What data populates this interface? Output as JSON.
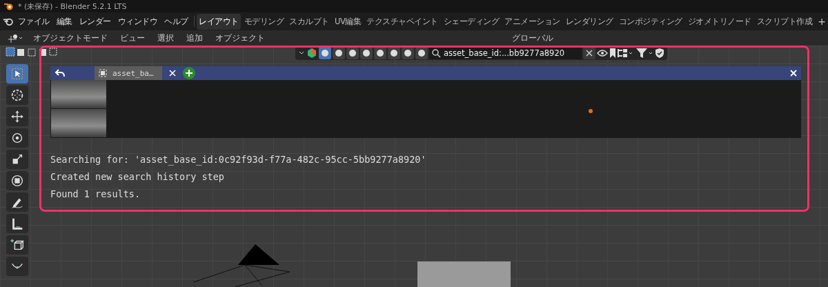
{
  "window": {
    "title": "* (未保存) - Blender 5.2.1 LTS"
  },
  "menu_bar": {
    "menus": [
      "ファイル",
      "編集",
      "レンダー",
      "ウィンドウ",
      "ヘルプ"
    ],
    "workspaces": [
      {
        "label": "レイアウト",
        "selected": true
      },
      {
        "label": "モデリング",
        "selected": false
      },
      {
        "label": "スカルプト",
        "selected": false
      },
      {
        "label": "UV編集",
        "selected": false
      },
      {
        "label": "テクスチャペイント",
        "selected": false
      },
      {
        "label": "シェーディング",
        "selected": false
      },
      {
        "label": "アニメーション",
        "selected": false
      },
      {
        "label": "レンダリング",
        "selected": false
      },
      {
        "label": "コンポジティング",
        "selected": false
      },
      {
        "label": "ジオメトリノード",
        "selected": false
      },
      {
        "label": "スクリプト作成",
        "selected": false
      }
    ],
    "add_label": "+"
  },
  "header": {
    "mode": "オブジェクトモード",
    "menus": [
      "ビュー",
      "選択",
      "追加",
      "オブジェクト"
    ],
    "orientation": "グローバル"
  },
  "viewport": {
    "tools": [
      {
        "kind": "select",
        "selected": true
      },
      {
        "kind": "cursor",
        "selected": false
      },
      {
        "kind": "move",
        "selected": false
      },
      {
        "kind": "rotate",
        "selected": false
      },
      {
        "kind": "scale",
        "selected": false
      },
      {
        "kind": "transform",
        "selected": false
      },
      {
        "kind": "annotate",
        "selected": false
      },
      {
        "kind": "measure",
        "selected": false
      },
      {
        "kind": "add-cube",
        "selected": false
      },
      {
        "kind": "curve",
        "selected": false
      }
    ],
    "search_bar": {
      "type_filters": [
        {
          "selected": true
        },
        {
          "selected": false
        },
        {
          "selected": false
        },
        {
          "selected": false
        },
        {
          "selected": false
        },
        {
          "selected": false
        },
        {
          "selected": false
        },
        {
          "selected": false
        }
      ],
      "query": "asset_base_id:...bb9277a8920"
    },
    "browser": {
      "tabs": [
        {
          "label": "asset_ba…",
          "selected": true
        }
      ],
      "results": [
        {
          "kind": "photo"
        },
        {
          "kind": "photo"
        }
      ],
      "log": [
        "Searching for: 'asset_base_id:0c92f93d-f77a-482c-95cc-5bb9277a8920'",
        "Created new search history step",
        "Found 1 results."
      ]
    }
  }
}
